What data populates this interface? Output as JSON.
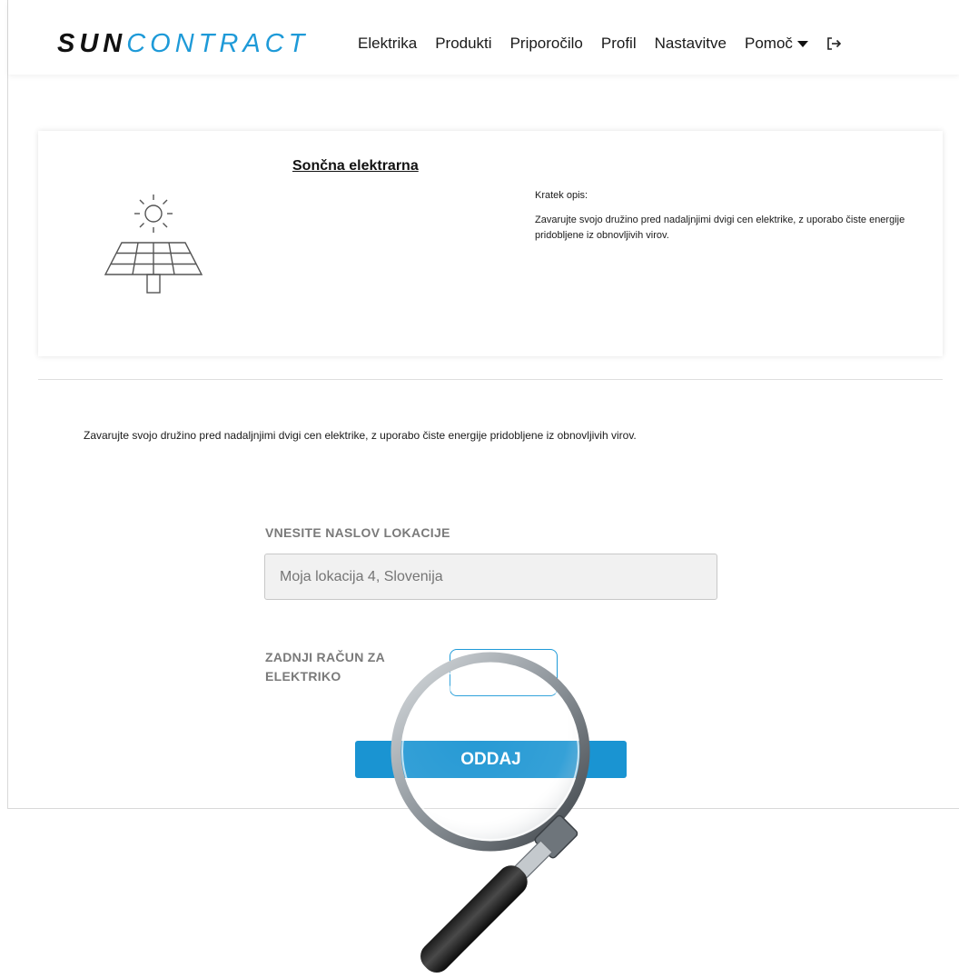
{
  "header": {
    "logo_part1": "SUN",
    "logo_part2": "CONTRACT",
    "nav": [
      "Elektrika",
      "Produkti",
      "Priporočilo",
      "Profil",
      "Nastavitve"
    ],
    "help_label": "Pomoč",
    "icons": {
      "help_dropdown": "caret-down-icon",
      "logout": "logout-icon"
    }
  },
  "card": {
    "title": "Sončna elektrarna",
    "icon": "solar-panel-icon",
    "desc_label": "Kratek opis:",
    "desc_text": "Zavarujte svojo družino pred nadaljnjimi dvigi cen elektrike, z uporabo čiste energije pridobljene iz obnovljivih virov."
  },
  "intro_text": "Zavarujte svojo družino pred nadaljnjimi dvigi cen elektrike, z uporabo čiste energije pridobljene iz obnovljivih virov.",
  "form": {
    "location_label": "VNESITE NASLOV LOKACIJE",
    "location_placeholder": "Moja lokacija 4, Slovenija",
    "bill_label": "ZADNJI RAČUN ZA ELEKTRIKO",
    "bill_value": "",
    "submit_label": "ODDAJ"
  },
  "overlay": {
    "icon": "magnifying-glass-icon"
  },
  "colors": {
    "accent": "#1e9ad8",
    "button": "#1a94d2",
    "label": "#7a7a7a",
    "input_bg": "#f1f1f1"
  }
}
